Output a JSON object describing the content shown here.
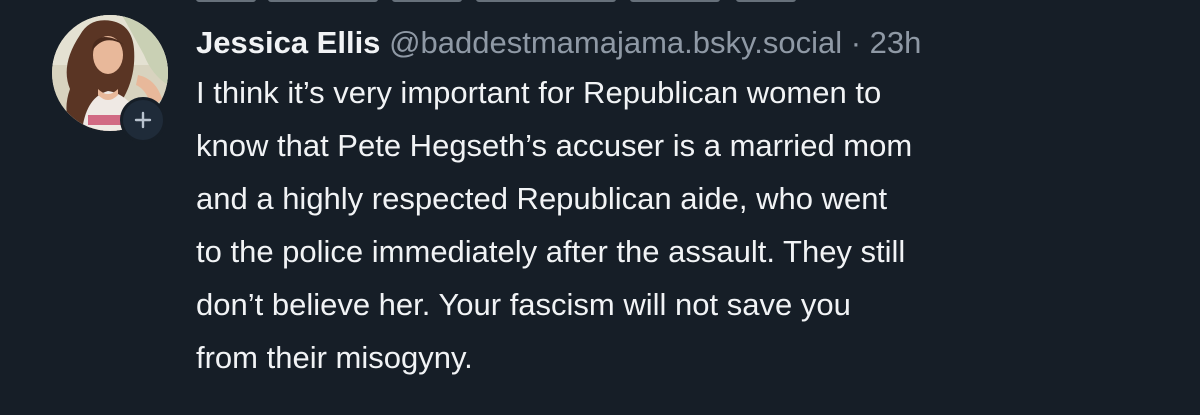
{
  "post": {
    "author_name": "Jessica Ellis",
    "handle": "@baddestmamajama.bsky.social",
    "separator": "·",
    "time": "23h",
    "text_lines": [
      "I think it’s very important for Republican women to",
      "know that Pete Hegseth’s accuser is a married mom",
      "and a highly respected Republican aide, who went",
      "to the police immediately after the assault. They still",
      "don’t believe her. Your fascism will not save you",
      "from their misogyny."
    ],
    "avatar_icon": "user-photo",
    "follow_icon": "plus-icon"
  },
  "colors": {
    "background": "#161e27",
    "text_primary": "#f1f3f5",
    "text_muted": "#8f99a5",
    "badge_bg": "#1f2b39"
  }
}
